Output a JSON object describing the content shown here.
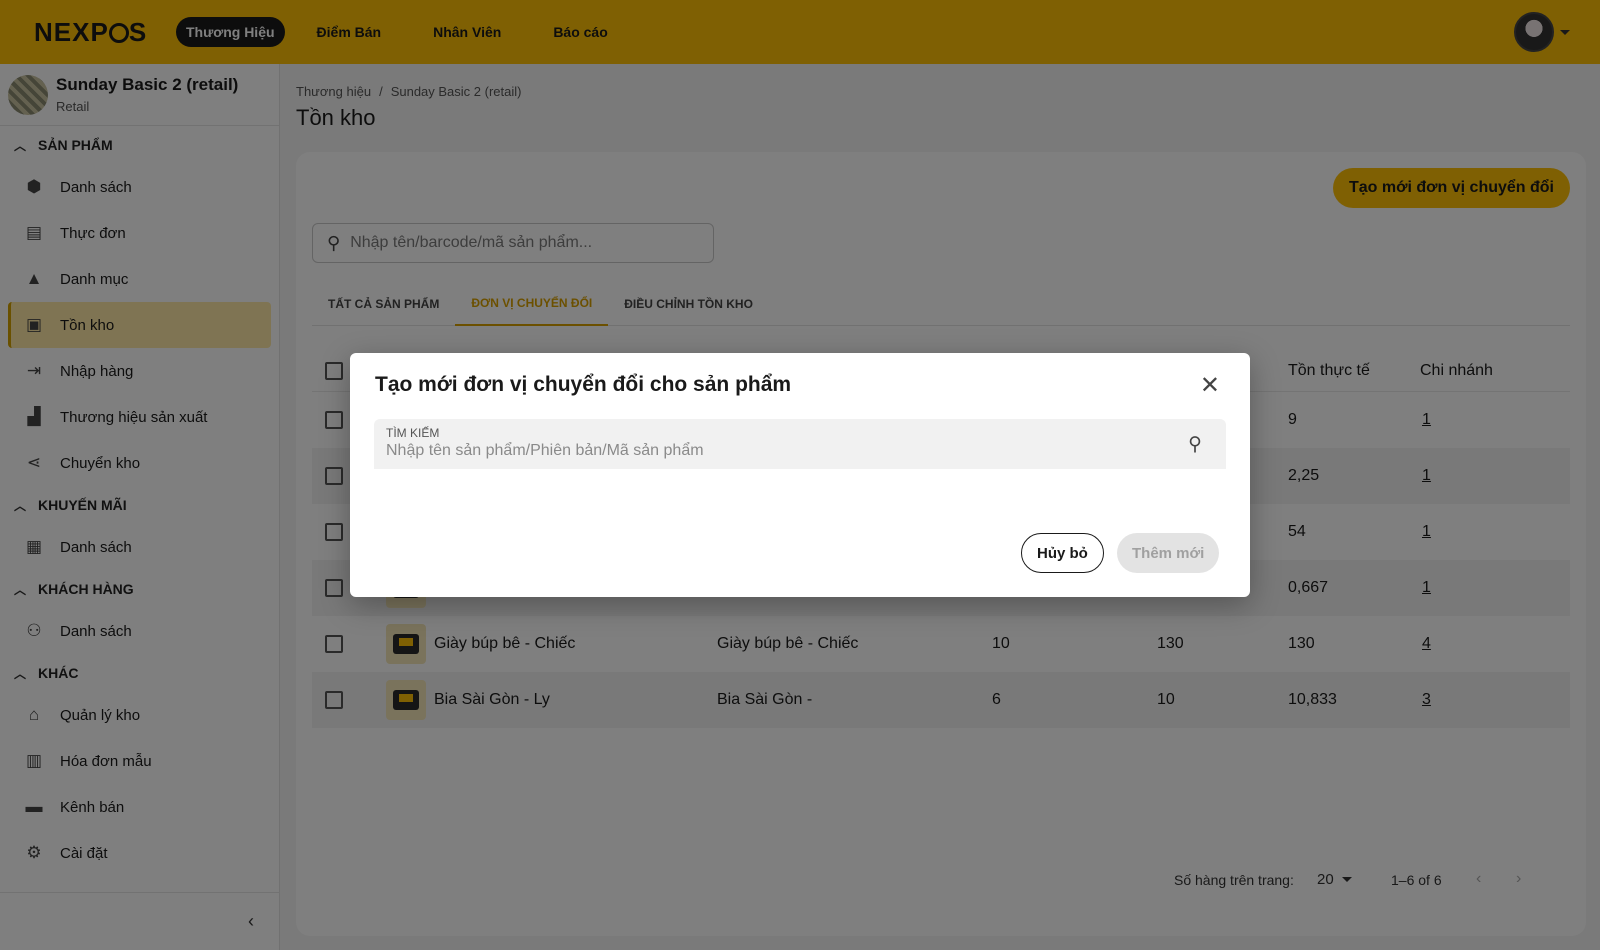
{
  "topbar": {
    "logo": "NEXP",
    "logo_tail": "S",
    "nav": [
      {
        "label": "Thương Hiệu",
        "active": true
      },
      {
        "label": "Điểm Bán",
        "active": false
      },
      {
        "label": "Nhân Viên",
        "active": false
      },
      {
        "label": "Báo cáo",
        "active": false
      }
    ]
  },
  "sidebar": {
    "store_name": "Sunday Basic 2 (retail)",
    "store_type": "Retail",
    "sections": [
      {
        "title": "SẢN PHẨM",
        "items": [
          {
            "label": "Danh sách",
            "icon": "box-icon"
          },
          {
            "label": "Thực đơn",
            "icon": "menu-book-icon"
          },
          {
            "label": "Danh mục",
            "icon": "category-icon"
          },
          {
            "label": "Tồn kho",
            "icon": "inventory-icon",
            "active": true
          },
          {
            "label": "Nhập hàng",
            "icon": "import-icon"
          },
          {
            "label": "Thương hiệu sản xuất",
            "icon": "factory-icon"
          },
          {
            "label": "Chuyển kho",
            "icon": "share-icon"
          }
        ]
      },
      {
        "title": "KHUYẾN MÃI",
        "items": [
          {
            "label": "Danh sách",
            "icon": "gift-icon"
          }
        ]
      },
      {
        "title": "KHÁCH HÀNG",
        "items": [
          {
            "label": "Danh sách",
            "icon": "people-icon"
          }
        ]
      },
      {
        "title": "KHÁC",
        "items": [
          {
            "label": "Quản lý kho",
            "icon": "warehouse-icon"
          },
          {
            "label": "Hóa đơn mẫu",
            "icon": "receipt-icon"
          },
          {
            "label": "Kênh bán",
            "icon": "store-icon"
          },
          {
            "label": "Cài đặt",
            "icon": "gear-icon"
          }
        ]
      }
    ]
  },
  "main": {
    "breadcrumb": [
      "Thương hiệu",
      "Sunday Basic 2 (retail)"
    ],
    "breadcrumb_sep": "/",
    "title": "Tồn kho",
    "create_button": "Tạo mới đơn vị chuyển đổi",
    "search_placeholder": "Nhập tên/barcode/mã sản phẩm...",
    "tabs": [
      {
        "label": "TẤT CẢ SẢN PHẨM",
        "active": false
      },
      {
        "label": "ĐƠN VỊ CHUYỂN ĐỔI",
        "active": true
      },
      {
        "label": "ĐIỀU CHỈNH TỒN KHO",
        "active": false
      }
    ],
    "table": {
      "headers": {
        "actual": "Tồn thực tế",
        "branch": "Chi nhánh"
      },
      "rows": [
        {
          "name": "",
          "base": "",
          "c1": "",
          "c2": "",
          "actual": "9",
          "branch": "1"
        },
        {
          "name": "",
          "base": "",
          "c1": "",
          "c2": "",
          "actual": "2,25",
          "branch": "1"
        },
        {
          "name": "",
          "base": "",
          "c1": "",
          "c2": "",
          "actual": "54",
          "branch": "1"
        },
        {
          "name": "",
          "base": "",
          "c1": "",
          "c2": "",
          "actual": "0,667",
          "branch": "1"
        },
        {
          "name": "Giày búp bê - Chiếc",
          "base": "Giày búp bê - Chiếc",
          "c1": "10",
          "c2": "130",
          "actual": "130",
          "branch": "4"
        },
        {
          "name": "Bia Sài Gòn - Ly",
          "base": "Bia Sài Gòn -",
          "c1": "6",
          "c2": "10",
          "actual": "10,833",
          "branch": "3"
        }
      ]
    },
    "footer": {
      "rows_label": "Số hàng trên trang:",
      "rows_value": "20",
      "range": "1–6 of 6"
    }
  },
  "dialog": {
    "title": "Tạo mới đơn vị chuyển đổi cho sản phẩm",
    "field_label": "TÌM KIẾM",
    "field_placeholder": "Nhập tên sản phẩm/Phiên bản/Mã sản phẩm",
    "cancel": "Hủy bỏ",
    "add": "Thêm mới"
  },
  "colors": {
    "accent": "#ffc107",
    "tab_active": "#d9a100",
    "sidebar_active": "#ffe9a6"
  }
}
